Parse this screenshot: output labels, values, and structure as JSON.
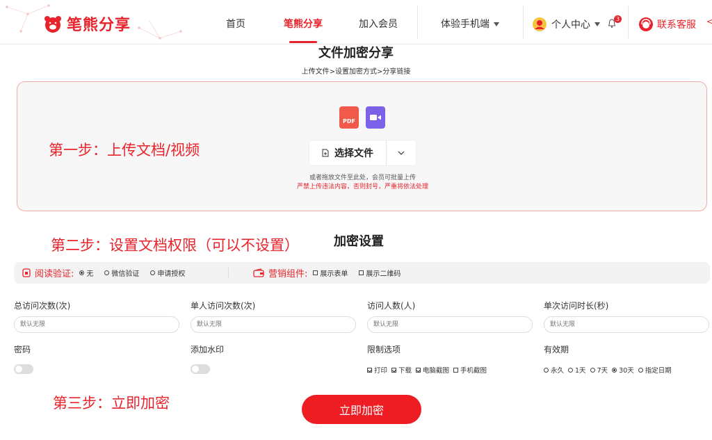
{
  "header": {
    "logo_text": "笔熊分享",
    "nav": {
      "home": "首页",
      "share": "笔熊分享",
      "member": "加入会员",
      "mobile": "体验手机端",
      "personal": "个人中心",
      "notify_count": "3",
      "service": "联系客服"
    }
  },
  "page": {
    "title": "文件加密分享",
    "steps": "上传文件>设置加密方式>分享链接"
  },
  "upload": {
    "step_note": "第一步：上传文档/视频",
    "pdf_label": "PDF",
    "choose_label": "选择文件",
    "hint": "或者拖放文件至此处，会员可批量上传",
    "warning": "严禁上传违法内容，否则封号，严重将依法处理"
  },
  "settings": {
    "step_note": "第二步：设置文档权限（可以不设置）",
    "title": "加密设置",
    "read_verify": {
      "label": "阅读验证:",
      "options": [
        "无",
        "微信验证",
        "申请授权"
      ],
      "selected": "无"
    },
    "marketing": {
      "label": "营销组件:",
      "options": [
        "展示表单",
        "展示二维码"
      ]
    },
    "fields": {
      "total_visits": {
        "label": "总访问次数(次)",
        "placeholder": "默认无限"
      },
      "single_visits": {
        "label": "单人访问次数(次)",
        "placeholder": "默认无限"
      },
      "visitors": {
        "label": "访问人数(人)",
        "placeholder": "默认无限"
      },
      "duration": {
        "label": "单次访问时长(秒)",
        "placeholder": "默认无限"
      }
    },
    "password": {
      "label": "密码",
      "enabled": false
    },
    "watermark": {
      "label": "添加水印",
      "enabled": false
    },
    "restrictions": {
      "label": "限制选项",
      "options": [
        "打印",
        "下载",
        "电脑截图",
        "手机截图"
      ],
      "checked": [
        "打印",
        "下载",
        "电脑截图"
      ]
    },
    "validity": {
      "label": "有效期",
      "options": [
        "永久",
        "1天",
        "7天",
        "30天",
        "指定日期"
      ],
      "selected": "30天"
    }
  },
  "submit": {
    "step_note": "第三步：立即加密",
    "label": "立即加密"
  },
  "colors": {
    "brand": "#e8232b",
    "accent_purple": "#7b61e8"
  }
}
